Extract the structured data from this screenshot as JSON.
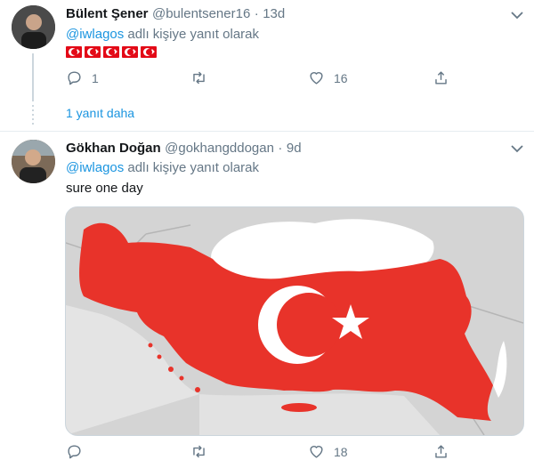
{
  "tweet1": {
    "name": "Bülent Şener",
    "handle": "@bulentsener16",
    "sep": "·",
    "time": "13d",
    "reply_handle": "@iwlagos",
    "reply_suffix": " adlı kişiye yanıt olarak",
    "flags_count": 5,
    "reply_count": "1",
    "like_count": "16"
  },
  "more_replies": "1 yanıt daha",
  "tweet2": {
    "name": "Gökhan Doğan",
    "handle": "@gokhangddogan",
    "sep": "·",
    "time": "9d",
    "reply_handle": "@iwlagos",
    "reply_suffix": " adlı kişiye yanıt olarak",
    "text": "sure one day",
    "like_count": "18"
  },
  "colors": {
    "link": "#1b95e0",
    "muted": "#657786",
    "flag_red": "#e30a17"
  },
  "icons": [
    "chevron-down-icon",
    "reply-icon",
    "retweet-icon",
    "like-icon",
    "share-icon"
  ]
}
